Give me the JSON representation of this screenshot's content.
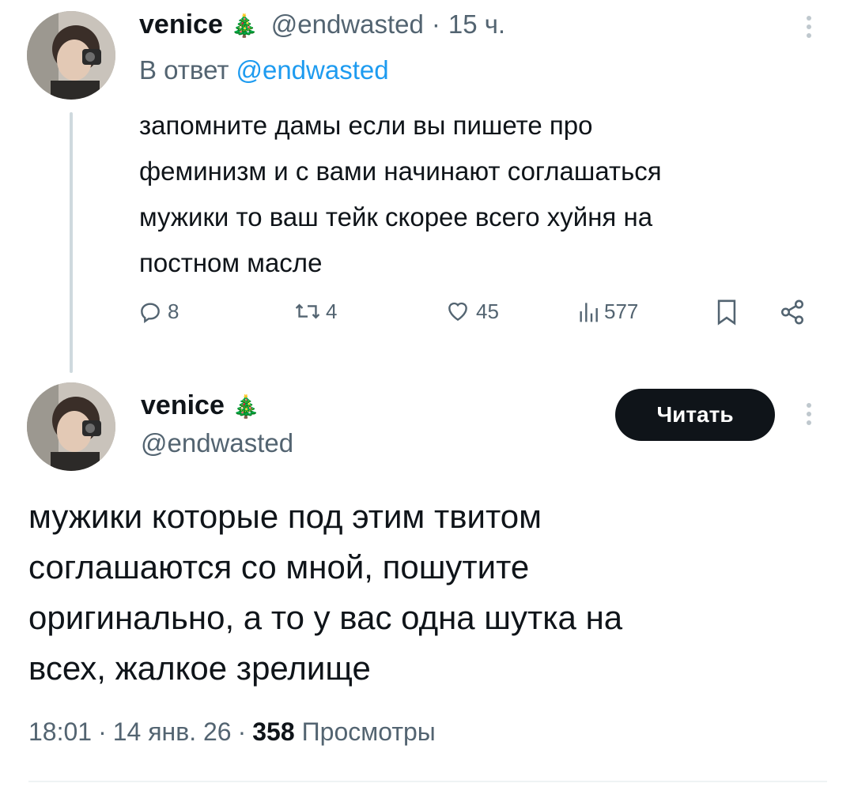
{
  "reply_tweet": {
    "display_name": "venice",
    "name_emoji": "🎄",
    "handle": "@endwasted",
    "time_sep": "·",
    "time_ago": "15 ч.",
    "reply_prefix": "В ответ",
    "reply_to": "@endwasted",
    "text": "запомните дамы если вы пишете про\nфеминизм и с вами начинают соглашаться\nмужики то ваш тейк скорее всего хуйня на\nпостном масле",
    "actions": {
      "replies": "8",
      "retweets": "4",
      "likes": "45",
      "views": "577"
    }
  },
  "main_tweet": {
    "display_name": "venice",
    "name_emoji": "🎄",
    "handle": "@endwasted",
    "follow_label": "Читать",
    "text": "мужики которые под этим твитом\nсоглашаются со мной, пошутите\nоригинально, а то у вас одна шутка на\nвсех, жалкое зрелище",
    "time": "18:01",
    "date": "14 янв. 26",
    "sep": "·",
    "views_count": "358",
    "views_label": "Просмотры"
  },
  "icons": {
    "reply": "speech-bubble-icon",
    "retweet": "retweet-icon",
    "like": "heart-icon",
    "views": "bar-chart-icon",
    "bookmark": "bookmark-icon",
    "share": "share-icon",
    "more": "more-vertical-icon"
  },
  "colors": {
    "text": "#0f1419",
    "secondary": "#536471",
    "link": "#1d9bf0",
    "button_bg": "#0f1419",
    "thread_line": "#cfd9de"
  }
}
